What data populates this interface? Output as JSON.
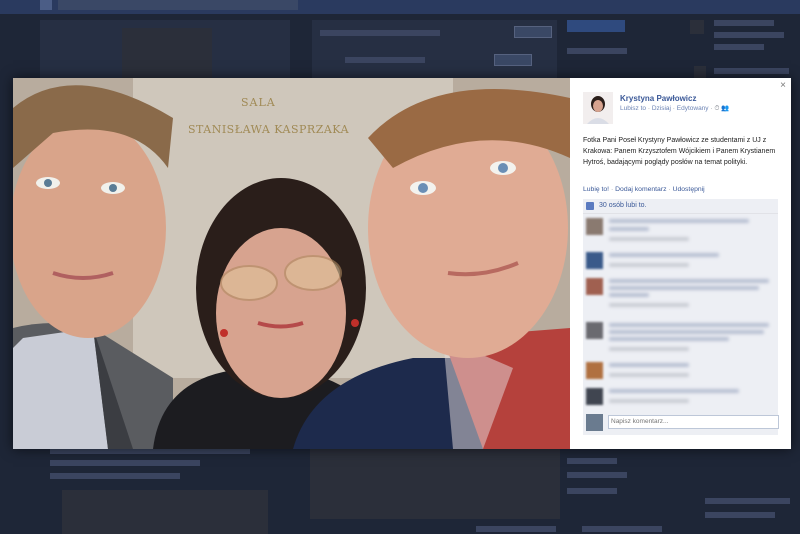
{
  "post": {
    "author": "Krystyna Pawłowicz",
    "meta_like": "Lubisz to",
    "meta_sep1": " · ",
    "meta_when": "Dzisiaj",
    "meta_sep2": " · ",
    "meta_edited": "Edytowany",
    "meta_tail": " · ⏱ 👥",
    "text": "Fotka Pani Poseł Krystyny Pawłowicz ze studentami z UJ z Krakowa: Panem Krzysztofem Wójcikiem i Panem Krystianem Hytroś, badającymi poglądy posłów na temat polityki.",
    "action_like": "Lubię to!",
    "action_comment": "Dodaj komentarz",
    "action_share": "Udostępnij",
    "action_sep": " · ",
    "likes_count": "30 osób lubi to.",
    "comment_placeholder": "Napisz komentarz...",
    "close_glyph": "×"
  },
  "photo": {
    "wall_sign_line1": "SALA",
    "wall_sign_line2": "STANISŁAWA KASPRZAKA"
  },
  "colors": {
    "link": "#3b5998",
    "panel_bg": "#edeff4",
    "backdrop": "#1e2637"
  }
}
